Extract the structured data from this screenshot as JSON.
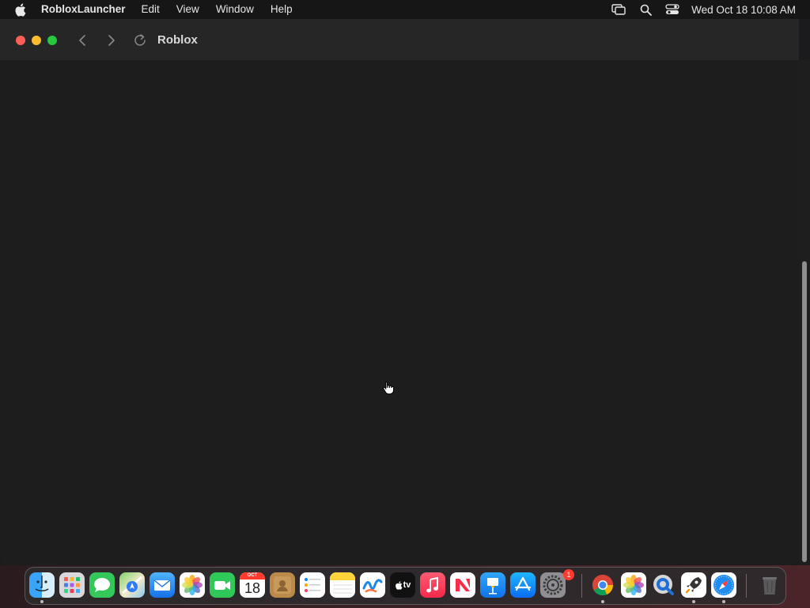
{
  "menubar": {
    "app_name": "RobloxLauncher",
    "items": [
      "Edit",
      "View",
      "Window",
      "Help"
    ],
    "clock": "Wed Oct 18  10:08 AM",
    "status_icons": [
      "screen-mirroring-icon",
      "spotlight-search-icon",
      "control-center-icon"
    ]
  },
  "window": {
    "title": "Roblox"
  },
  "dock": {
    "apps": [
      {
        "name": "Finder",
        "icon": "finder-icon",
        "running": true
      },
      {
        "name": "Launchpad",
        "icon": "launchpad-icon",
        "running": false
      },
      {
        "name": "Messages",
        "icon": "messages-icon",
        "running": false
      },
      {
        "name": "Maps",
        "icon": "maps-icon",
        "running": false
      },
      {
        "name": "Mail",
        "icon": "mail-icon",
        "running": false
      },
      {
        "name": "Photos",
        "icon": "photos-icon",
        "running": false
      },
      {
        "name": "FaceTime",
        "icon": "facetime-icon",
        "running": false
      },
      {
        "name": "Calendar",
        "icon": "calendar-icon",
        "running": false,
        "month": "OCT",
        "day": "18"
      },
      {
        "name": "Contacts",
        "icon": "contacts-icon",
        "running": false
      },
      {
        "name": "Reminders",
        "icon": "reminders-icon",
        "running": false
      },
      {
        "name": "Notes",
        "icon": "notes-icon",
        "running": false
      },
      {
        "name": "Freeform",
        "icon": "freeform-icon",
        "running": false
      },
      {
        "name": "TV",
        "icon": "apple-tv-icon",
        "running": false,
        "label": "tv"
      },
      {
        "name": "Music",
        "icon": "music-icon",
        "running": false
      },
      {
        "name": "News",
        "icon": "news-icon",
        "running": false
      },
      {
        "name": "Keynote",
        "icon": "keynote-icon",
        "running": false
      },
      {
        "name": "App Store",
        "icon": "app-store-icon",
        "running": false
      },
      {
        "name": "System Settings",
        "icon": "system-settings-icon",
        "running": false,
        "badge": "1"
      },
      {
        "name": "Chrome",
        "icon": "chrome-icon",
        "running": true
      },
      {
        "name": "Photos",
        "icon": "photos-icon",
        "running": false
      },
      {
        "name": "QuickTime Player",
        "icon": "quicktime-icon",
        "running": false
      },
      {
        "name": "Roblox Launcher",
        "icon": "rocket-icon",
        "running": true
      },
      {
        "name": "Safari",
        "icon": "safari-icon",
        "running": true
      },
      {
        "name": "Trash",
        "icon": "trash-icon",
        "running": false
      }
    ]
  }
}
